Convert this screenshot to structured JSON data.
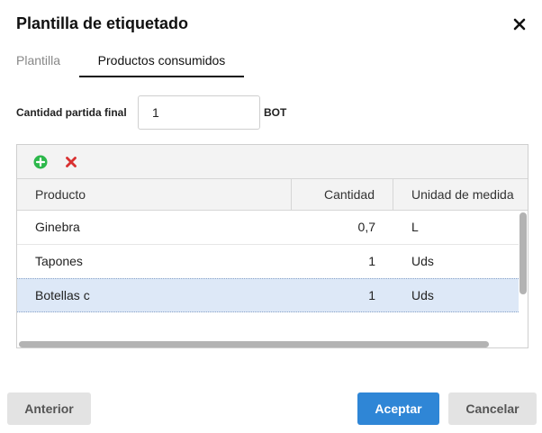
{
  "dialog": {
    "title": "Plantilla de etiquetado"
  },
  "tabs": [
    {
      "label": "Plantilla",
      "active": false
    },
    {
      "label": "Productos consumidos",
      "active": true
    }
  ],
  "quantity": {
    "label": "Cantidad partida final",
    "value": "1",
    "unit": "BOT"
  },
  "grid": {
    "toolbar": {
      "add_icon": "plus-circle-icon",
      "delete_icon": "x-icon"
    },
    "columns": [
      "Producto",
      "Cantidad",
      "Unidad de medida"
    ],
    "rows": [
      {
        "producto": "Ginebra",
        "cantidad": "0,7",
        "unidad": "L",
        "selected": false
      },
      {
        "producto": "Tapones",
        "cantidad": "1",
        "unidad": "Uds",
        "selected": false
      },
      {
        "producto": "Botellas c",
        "cantidad": "1",
        "unidad": "Uds",
        "selected": true
      }
    ]
  },
  "buttons": {
    "previous": "Anterior",
    "accept": "Aceptar",
    "cancel": "Cancelar"
  },
  "colors": {
    "accent": "#2f86d6",
    "add": "#2db84b",
    "delete": "#d93030",
    "selected_row": "#dde8f7"
  }
}
